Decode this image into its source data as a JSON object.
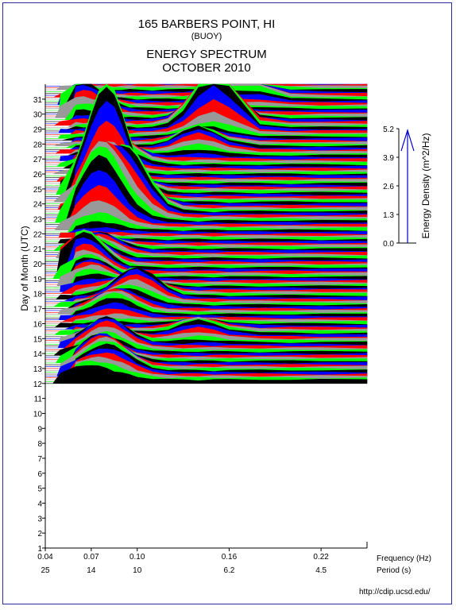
{
  "header": {
    "station": "165 BARBERS POINT, HI",
    "type": "(BUOY)",
    "product": "ENERGY SPECTRUM",
    "month": "OCTOBER 2010"
  },
  "footer": {
    "url": "http://cdip.ucsd.edu/"
  },
  "colors": {
    "frame": "#2a2a9a",
    "cycle": [
      "#000000",
      "#00ff00",
      "#999999",
      "#ff0000",
      "#0000ff"
    ],
    "scale_arrow": "#0000cc"
  },
  "chart_data": {
    "type": "area",
    "title": "ENERGY SPECTRUM",
    "ylabel": "Day of Month (UTC)",
    "xlabel": "Frequency (Hz)",
    "x2label": "Period (s)",
    "x_ticks": [
      "0.04",
      "0.07",
      "0.10",
      "0.16",
      "0.22"
    ],
    "x_tick_values": [
      0.04,
      0.07,
      0.1,
      0.16,
      0.22
    ],
    "period_ticks": [
      "25",
      "14",
      "10",
      "6.2",
      "4.5"
    ],
    "xlim": [
      0.04,
      0.25
    ],
    "y_ticks": [
      "1",
      "2",
      "3",
      "4",
      "5",
      "6",
      "7",
      "8",
      "9",
      "10",
      "11",
      "12",
      "13",
      "14",
      "15",
      "16",
      "17",
      "18",
      "19",
      "20",
      "21",
      "22",
      "23",
      "24",
      "25",
      "26",
      "27",
      "28",
      "29",
      "30",
      "31"
    ],
    "ylim": [
      1,
      32
    ],
    "scale": {
      "label": "Energy Density (m^2/Hz)",
      "ticks": [
        "0.0",
        "1.3",
        "2.6",
        "3.9",
        "5.2"
      ],
      "values": [
        0.0,
        1.3,
        2.6,
        3.9,
        5.2
      ]
    },
    "data_start_day": 12,
    "data_end_day": 31.9,
    "records_per_day": 8,
    "frequencies": [
      0.04,
      0.05,
      0.06,
      0.065,
      0.07,
      0.075,
      0.08,
      0.085,
      0.09,
      0.095,
      0.1,
      0.11,
      0.12,
      0.13,
      0.14,
      0.15,
      0.16,
      0.18,
      0.2,
      0.22,
      0.25
    ],
    "peak_events": [
      {
        "day": 12.1,
        "freq": 0.065,
        "energy": 0.6
      },
      {
        "day": 12.6,
        "freq": 0.085,
        "energy": 0.8
      },
      {
        "day": 13.2,
        "freq": 0.075,
        "energy": 1.1
      },
      {
        "day": 14.4,
        "freq": 0.08,
        "energy": 1.2
      },
      {
        "day": 15.2,
        "freq": 0.14,
        "energy": 0.6
      },
      {
        "day": 16.6,
        "freq": 0.085,
        "energy": 0.9
      },
      {
        "day": 17.6,
        "freq": 0.1,
        "energy": 1.3
      },
      {
        "day": 18.6,
        "freq": 0.07,
        "energy": 0.8
      },
      {
        "day": 19.6,
        "freq": 0.065,
        "energy": 1.6
      },
      {
        "day": 20.6,
        "freq": 0.075,
        "energy": 0.8
      },
      {
        "day": 22.8,
        "freq": 0.075,
        "energy": 3.2
      },
      {
        "day": 23.4,
        "freq": 0.095,
        "energy": 2.6
      },
      {
        "day": 24.6,
        "freq": 0.08,
        "energy": 5.0
      },
      {
        "day": 26.6,
        "freq": 0.085,
        "energy": 1.2
      },
      {
        "day": 27.6,
        "freq": 0.14,
        "energy": 0.9
      },
      {
        "day": 29.1,
        "freq": 0.15,
        "energy": 3.0
      },
      {
        "day": 30.1,
        "freq": 0.065,
        "energy": 1.2
      },
      {
        "day": 31.1,
        "freq": 0.17,
        "energy": 0.8
      }
    ]
  }
}
